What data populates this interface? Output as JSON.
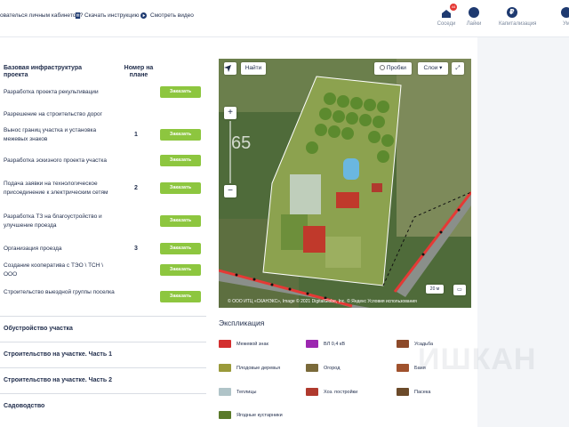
{
  "topbar": {
    "link_cabinet": "ователься личным кабинетом?",
    "link_instruction": "Скачать инструкцию",
    "link_video": "Смотреть видео",
    "icons": [
      {
        "label": "Соседи",
        "icon": "neighbors-icon",
        "badge": "44"
      },
      {
        "label": "Лайки",
        "icon": "chat-icon"
      },
      {
        "label": "Капитализация",
        "icon": "ruble-icon"
      },
      {
        "label": "Ум",
        "icon": "profile-icon"
      }
    ]
  },
  "table": {
    "col_name": "Базовая инфраструктура проекта",
    "col_num": "Номер на плане",
    "order_label": "Заказать",
    "rows": [
      {
        "name": "Разработка проекта рекультивации",
        "num": "",
        "button": true
      },
      {
        "name": "Разрешение на строительство дорог",
        "num": "",
        "button": false
      },
      {
        "name": "Вынос границ участка и установка межевых знаков",
        "num": "1",
        "button": true
      },
      {
        "name": "Разработка эскизного проекта участка",
        "num": "",
        "button": true
      },
      {
        "name": "Подача заявки на технологическое присоединение к электрическим сетям",
        "num": "2",
        "button": true
      },
      {
        "name": "Разработка ТЗ на благоустройство и улучшение проезда",
        "num": "",
        "button": true
      },
      {
        "name": "Организация проезда",
        "num": "3",
        "button": true
      },
      {
        "name": "Создание кооператива с ТЭО \\ ТСН \\ ООО",
        "num": "",
        "button": true
      },
      {
        "name": "Строительство выездной группы поселка",
        "num": "",
        "button": true
      }
    ]
  },
  "sections": [
    "Обустройство участка",
    "Строительство на участке. Часть 1",
    "Строительство на участке. Часть 2",
    "Садоводство"
  ],
  "map": {
    "find_label": "Найти",
    "traffic_label": "Пробки",
    "layers_label": "Слои",
    "zoom_in": "+",
    "zoom_out": "−",
    "zoom_level": "65",
    "scale": "20 м",
    "copyright": "© ООО ИТЦ «СКАНЭКС», Image © 2021 DigitalGlobe, Inc. © Яндекс Условия использования"
  },
  "explication": {
    "title": "Экспликация",
    "items": [
      {
        "label": "Межевой знак",
        "color": "#d32f2f"
      },
      {
        "label": "ВЛ 0,4 кВ",
        "color": "#9c27b0"
      },
      {
        "label": "Усадьба",
        "color": "#8d4a2a"
      },
      {
        "label": "Плодовые деревья",
        "color": "#9a9a3a"
      },
      {
        "label": "Огород",
        "color": "#7a6a3a"
      },
      {
        "label": "Баня",
        "color": "#a0522d"
      },
      {
        "label": "Теплицы",
        "color": "#b0c4c8"
      },
      {
        "label": "Хоз. постройки",
        "color": "#b03a2e"
      },
      {
        "label": "Пасека",
        "color": "#6b4a2a"
      },
      {
        "label": "Ягодные кустарники",
        "color": "#5a7a2a"
      }
    ],
    "watermark": "ИШКАН"
  }
}
